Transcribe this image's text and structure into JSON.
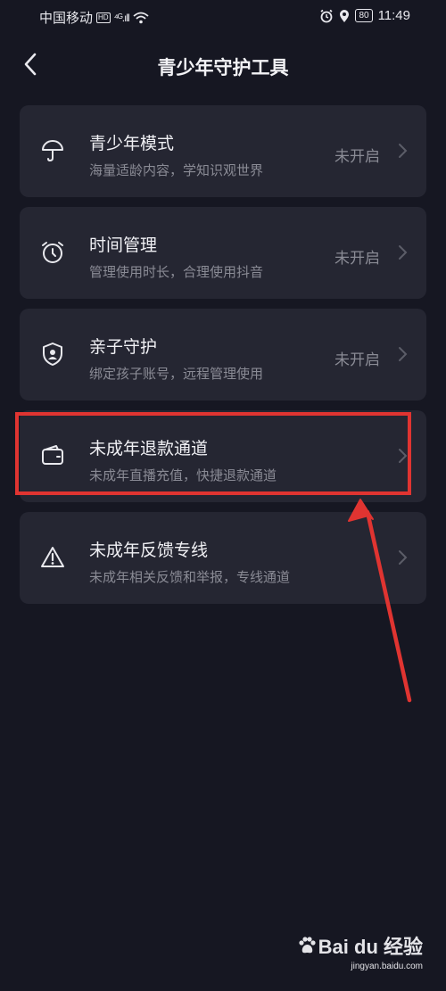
{
  "status_bar": {
    "carrier": "中国移动",
    "hd": "HD",
    "signal": "⁴ᴳ.ıll",
    "battery": "80",
    "time": "11:49"
  },
  "header": {
    "title": "青少年守护工具"
  },
  "menu": [
    {
      "title": "青少年模式",
      "subtitle": "海量适龄内容，学知识观世界",
      "status": "未开启",
      "icon": "umbrella-icon"
    },
    {
      "title": "时间管理",
      "subtitle": "管理使用时长，合理使用抖音",
      "status": "未开启",
      "icon": "alarm-clock-icon"
    },
    {
      "title": "亲子守护",
      "subtitle": "绑定孩子账号，远程管理使用",
      "status": "未开启",
      "icon": "shield-user-icon"
    },
    {
      "title": "未成年退款通道",
      "subtitle": "未成年直播充值，快捷退款通道",
      "status": "",
      "icon": "wallet-icon"
    },
    {
      "title": "未成年反馈专线",
      "subtitle": "未成年相关反馈和举报，专线通道",
      "status": "",
      "icon": "warning-icon"
    }
  ],
  "annotation": {
    "highlight_color": "#e03431"
  },
  "watermark": {
    "logo": "Bai du 经验",
    "url": "jingyan.baidu.com"
  },
  "colors": {
    "background": "#161722",
    "card": "#252632",
    "muted_text": "#8a8b95"
  }
}
